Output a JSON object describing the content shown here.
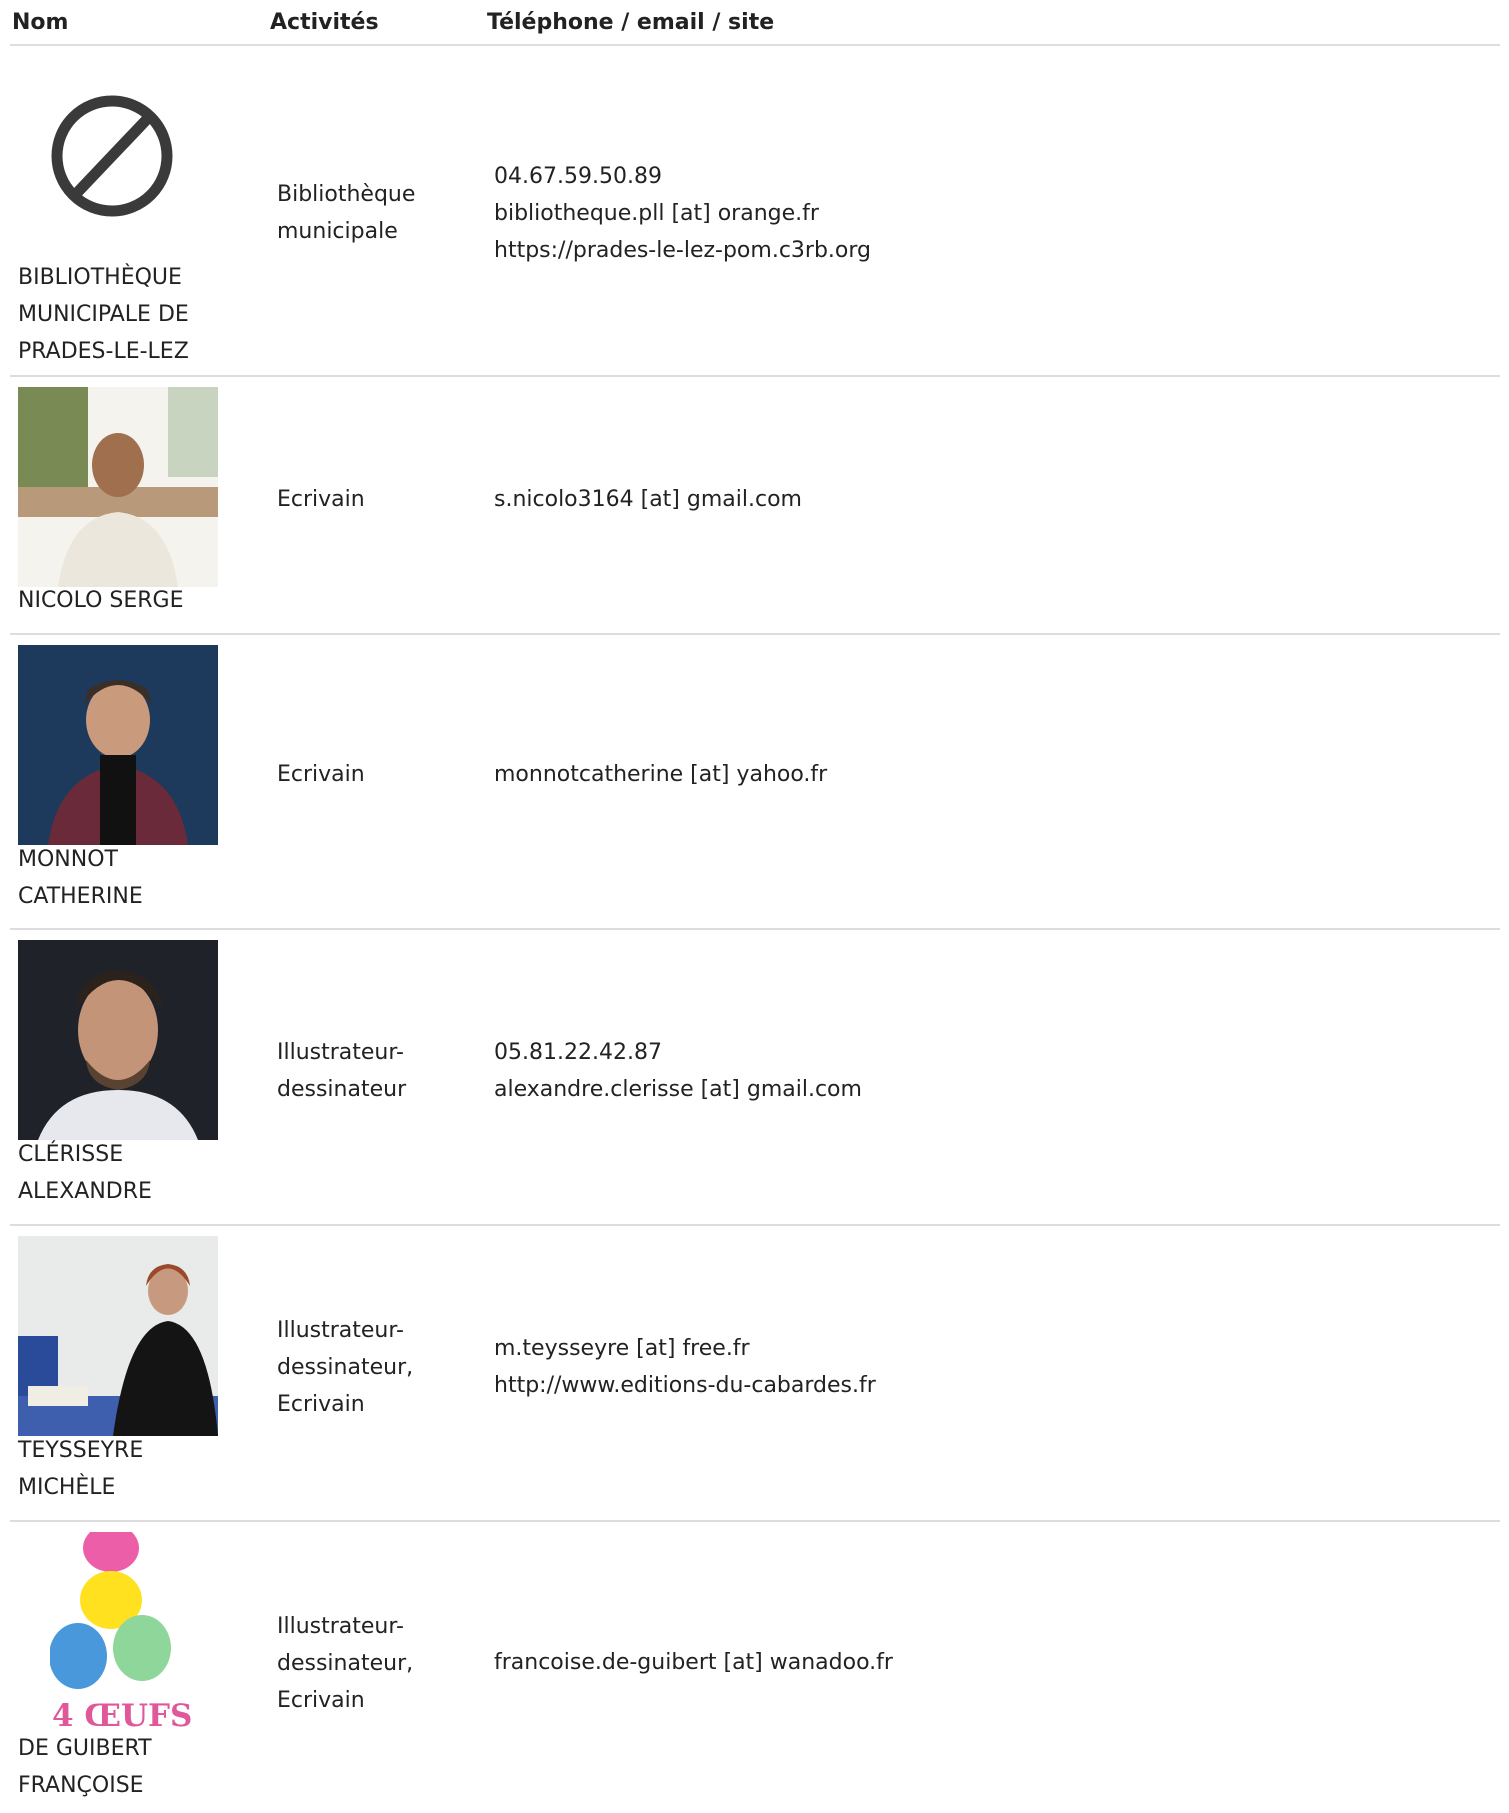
{
  "table": {
    "headers": {
      "name": "Nom",
      "activities": "Activités",
      "contact": "Téléphone / email / site"
    },
    "rows": [
      {
        "name_lines": [
          "BIBLIOTHÈQUE",
          "MUNICIPALE DE",
          "PRADES-LE-LEZ"
        ],
        "photo": "prohibited-icon",
        "activity_lines": [
          "Bibliothèque",
          "municipale"
        ],
        "contact_lines": [
          "04.67.59.50.89",
          "bibliotheque.pll [at] orange.fr",
          "https://prades-le-lez-pom.c3rb.org"
        ]
      },
      {
        "name_lines": [
          "NICOLO SERGE"
        ],
        "photo": "portrait-photo",
        "activity_lines": [
          "Ecrivain"
        ],
        "contact_lines": [
          "s.nicolo3164 [at] gmail.com"
        ]
      },
      {
        "name_lines": [
          "MONNOT",
          "CATHERINE"
        ],
        "photo": "portrait-photo",
        "activity_lines": [
          "Ecrivain"
        ],
        "contact_lines": [
          "monnotcatherine [at] yahoo.fr"
        ]
      },
      {
        "name_lines": [
          "CLÉRISSE",
          "ALEXANDRE"
        ],
        "photo": "portrait-photo",
        "activity_lines": [
          "Illustrateur-",
          "dessinateur"
        ],
        "contact_lines": [
          "05.81.22.42.87",
          "alexandre.clerisse [at] gmail.com"
        ]
      },
      {
        "name_lines": [
          "TEYSSEYRE",
          "MICHÈLE"
        ],
        "photo": "portrait-photo",
        "activity_lines": [
          "Illustrateur-",
          "dessinateur,",
          "Ecrivain"
        ],
        "contact_lines": [
          "m.teysseyre [at] free.fr",
          "http://www.editions-du-cabardes.fr"
        ]
      },
      {
        "name_lines": [
          "DE GUIBERT",
          "FRANÇOISE"
        ],
        "photo": "book-cover-logo",
        "logo_text": "4 ŒUFS",
        "activity_lines": [
          "Illustrateur-",
          "dessinateur,",
          "Ecrivain"
        ],
        "contact_lines": [
          "francoise.de-guibert [at] wanadoo.fr"
        ]
      }
    ]
  }
}
